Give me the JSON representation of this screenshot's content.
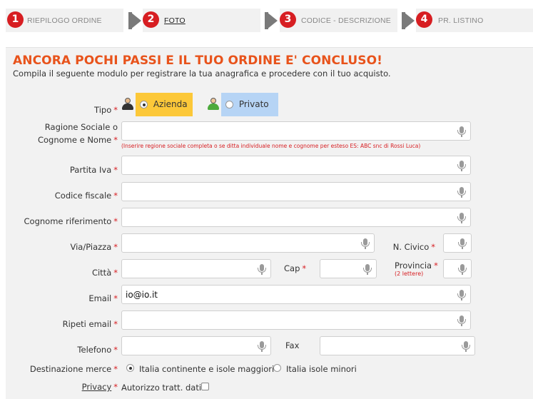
{
  "steps": [
    {
      "num": "1",
      "label": "RIEPILOGO ORDINE"
    },
    {
      "num": "2",
      "label": "FOTO"
    },
    {
      "num": "3",
      "label": "CODICE - DESCRIZIONE"
    },
    {
      "num": "4",
      "label": "PR. LISTINO"
    }
  ],
  "form": {
    "title": "ANCORA POCHI PASSI E IL TUO ORDINE E' CONCLUSO!",
    "subtitle": "Compila il seguente modulo per registrare la tua anagrafica e procedere con il tuo acquisto.",
    "required_mark": "*",
    "tipo": {
      "label": "Tipo",
      "options": [
        "Azienda",
        "Privato"
      ],
      "selected": "Azienda"
    },
    "ragione_sociale": {
      "label_line1": "Ragione Sociale o",
      "label_line2": "Cognome e Nome",
      "value": "",
      "hint": "(Inserire regione sociale completa o se ditta individuale nome e cognome per esteso ES: ABC snc di Rossi Luca)"
    },
    "partita_iva": {
      "label": "Partita Iva",
      "value": ""
    },
    "codice_fiscale": {
      "label": "Codice fiscale",
      "value": ""
    },
    "cognome_riferimento": {
      "label": "Cognome riferimento",
      "value": ""
    },
    "via": {
      "label": "Via/Piazza",
      "value": ""
    },
    "civico": {
      "label": "N. Civico",
      "value": ""
    },
    "citta": {
      "label": "Città",
      "value": ""
    },
    "cap": {
      "label": "Cap",
      "value": ""
    },
    "provincia": {
      "label": "Provincia",
      "note": "(2 lettere)",
      "value": ""
    },
    "email": {
      "label": "Email",
      "value": "io@io.it"
    },
    "ripeti_email": {
      "label": "Ripeti email",
      "value": ""
    },
    "telefono": {
      "label": "Telefono",
      "value": ""
    },
    "fax": {
      "label": "Fax",
      "value": ""
    },
    "destinazione": {
      "label": "Destinazione merce",
      "options": [
        "Italia continente e isole maggiori",
        "Italia isole minori"
      ],
      "selected": "Italia continente e isole maggiori"
    },
    "privacy": {
      "label": "Privacy",
      "checkbox_label": "Autorizzo tratt. dati",
      "checked": false
    }
  },
  "colors": {
    "accent": "#e8531b",
    "step_badge": "#d71e22",
    "azienda_bg": "#fcc839",
    "privato_bg": "#b6d4f5"
  }
}
